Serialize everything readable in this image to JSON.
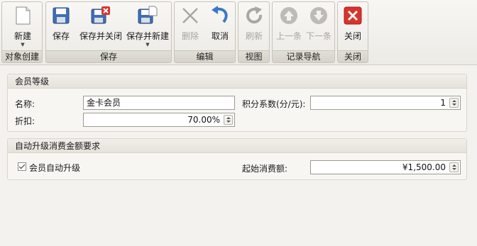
{
  "ribbon": {
    "groups": {
      "create": {
        "title": "对象创建",
        "new": "新建"
      },
      "save": {
        "title": "保存",
        "save": "保存",
        "save_close": "保存并关闭",
        "save_new": "保存并新建"
      },
      "edit": {
        "title": "编辑",
        "delete": "删除",
        "cancel": "取消"
      },
      "view": {
        "title": "视图",
        "refresh": "刷新"
      },
      "nav": {
        "title": "记录导航",
        "prev": "上一条",
        "next": "下一条"
      },
      "close": {
        "title": "关闭",
        "close": "关闭"
      }
    }
  },
  "member_level": {
    "header": "会员等级",
    "name_label": "名称:",
    "name_value": "金卡会员",
    "points_label": "积分系数(分/元):",
    "points_value": "1",
    "discount_label": "折扣:",
    "discount_value": "70.00%"
  },
  "auto_upgrade": {
    "header": "自动升级消费金额要求",
    "checkbox_label": "会员自动升级",
    "checked": true,
    "min_spend_label": "起始消费额:",
    "min_spend_value": "¥1,500.00"
  },
  "colors": {
    "close_red": "#d9332b",
    "save_blue": "#3f6fb6",
    "cancel_blue": "#3a78c9"
  }
}
